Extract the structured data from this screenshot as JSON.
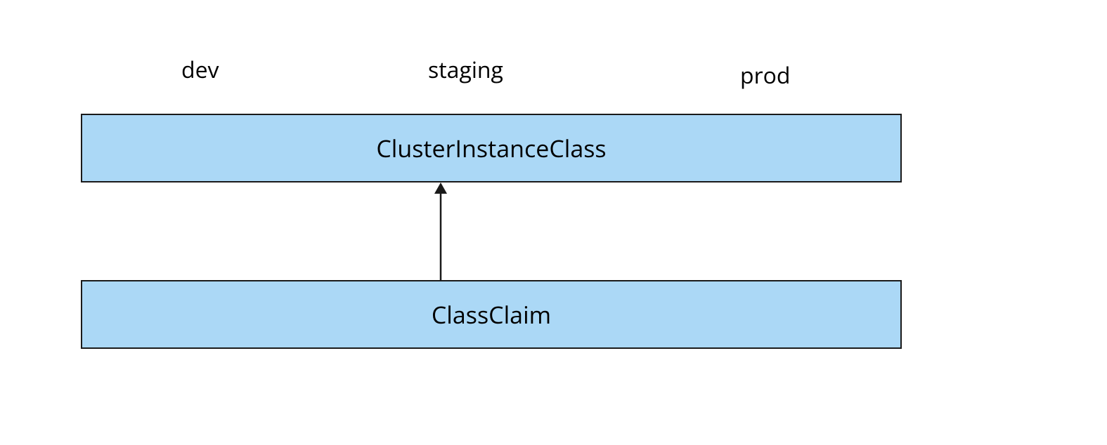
{
  "diagram": {
    "environments": {
      "dev": "dev",
      "staging": "staging",
      "prod": "prod"
    },
    "boxes": {
      "top": "ClusterInstanceClass",
      "bottom": "ClassClaim"
    },
    "colors": {
      "box_fill": "#abd8f6",
      "box_border": "#1a1a1a"
    },
    "relationship": "bottom-points-to-top"
  }
}
